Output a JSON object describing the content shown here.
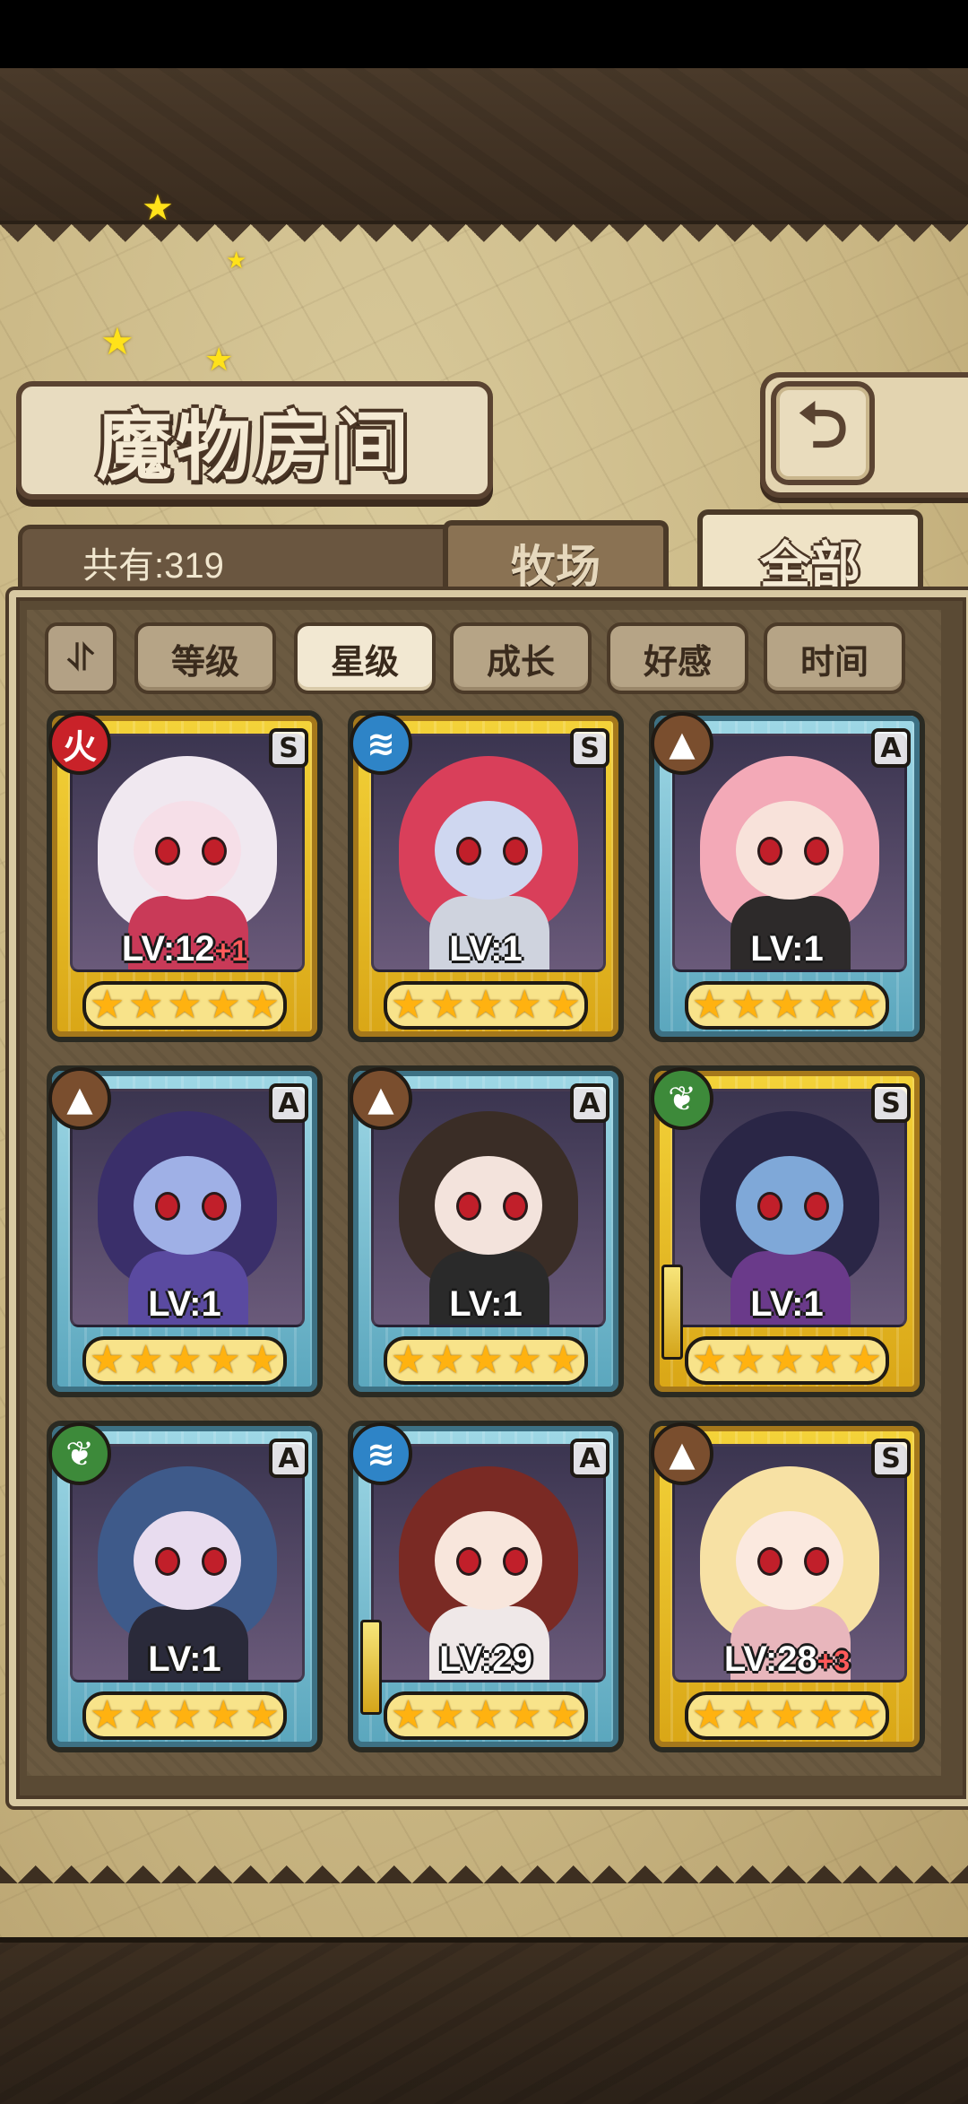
{
  "title": "魔物房间",
  "count_label": "共有:319",
  "tabs": {
    "farm": "牧场",
    "all": "全部"
  },
  "sort_toggle": "⥯",
  "filters": [
    {
      "label": "等级",
      "active": false
    },
    {
      "label": "星级",
      "active": true
    },
    {
      "label": "成长",
      "active": false
    },
    {
      "label": "好感",
      "active": false
    },
    {
      "label": "时间",
      "active": false
    }
  ],
  "monsters": [
    {
      "element": "fire",
      "rank": "S",
      "level": "LV:12",
      "bonus": "+1",
      "stars": 5,
      "frame": "gold",
      "hair": "#f0e8f0",
      "skin": "#f6dfe8",
      "outfit": "#c93a58",
      "icon": "火"
    },
    {
      "element": "water",
      "rank": "S",
      "level": "LV:1",
      "bonus": "",
      "stars": 5,
      "frame": "gold",
      "hair": "#d93f5a",
      "skin": "#cfd7f0",
      "outfit": "#cfd3de",
      "icon": "≋"
    },
    {
      "element": "earth",
      "rank": "A",
      "level": "LV:1",
      "bonus": "",
      "stars": 5,
      "frame": "blue",
      "hair": "#f3a9b7",
      "skin": "#f8e2da",
      "outfit": "#2d2a2a",
      "icon": "▲"
    },
    {
      "element": "earth",
      "rank": "A",
      "level": "LV:1",
      "bonus": "",
      "stars": 5,
      "frame": "blue",
      "hair": "#3a2f6a",
      "skin": "#9fb0e6",
      "outfit": "#5a4aa0",
      "icon": "▲"
    },
    {
      "element": "earth",
      "rank": "A",
      "level": "LV:1",
      "bonus": "",
      "stars": 5,
      "frame": "blue",
      "hair": "#3a2d26",
      "skin": "#f3e3dc",
      "outfit": "#2a2a2a",
      "icon": "▲"
    },
    {
      "element": "wood",
      "rank": "S",
      "level": "LV:1",
      "bonus": "",
      "stars": 5,
      "frame": "gold",
      "hair": "#2a2646",
      "skin": "#7fa8d8",
      "outfit": "#6a3a8a",
      "icon": "❦"
    },
    {
      "element": "wood",
      "rank": "A",
      "level": "LV:1",
      "bonus": "",
      "stars": 5,
      "frame": "blue",
      "hair": "#3e5a8a",
      "skin": "#e8dcef",
      "outfit": "#2a2a3a",
      "icon": "❦"
    },
    {
      "element": "water",
      "rank": "A",
      "level": "LV:29",
      "bonus": "",
      "stars": 5,
      "frame": "blue",
      "hair": "#7a2a24",
      "skin": "#f8e6dc",
      "outfit": "#efe8e8",
      "icon": "≋"
    },
    {
      "element": "earth",
      "rank": "S",
      "level": "LV:28",
      "bonus": "+3",
      "stars": 5,
      "frame": "gold",
      "hair": "#f7e1a4",
      "skin": "#fbe9df",
      "outfit": "#e8b6bc",
      "icon": "▲"
    }
  ],
  "colors": {
    "frame_gold": "#f4d33a",
    "frame_blue": "#9fd8e6",
    "parchment": "#c9b683"
  }
}
